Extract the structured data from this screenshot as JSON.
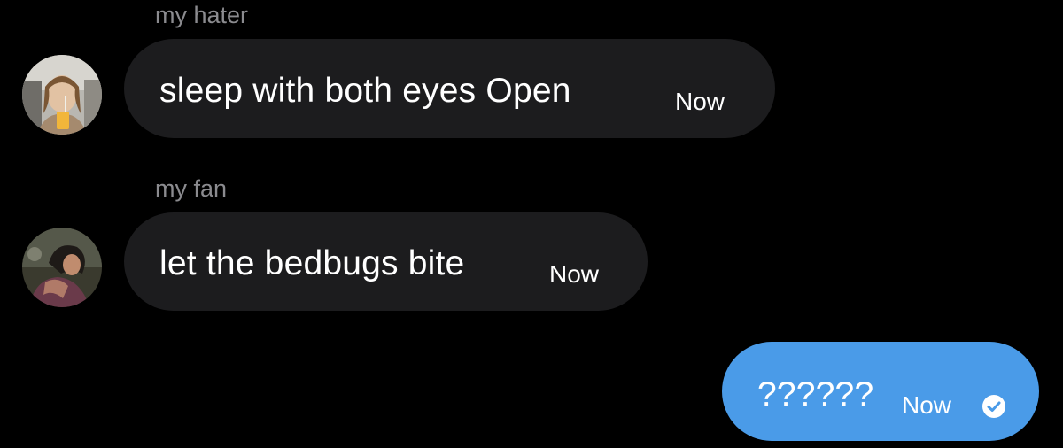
{
  "conversation": {
    "messages": [
      {
        "sender": "my hater",
        "text": "sleep with both eyes Open",
        "time": "Now",
        "direction": "incoming",
        "avatar_icon": "user-avatar-photo"
      },
      {
        "sender": "my fan",
        "text": "let the bedbugs bite",
        "time": "Now",
        "direction": "incoming",
        "avatar_icon": "user-avatar-photo"
      },
      {
        "sender": "",
        "text": "??????",
        "time": "Now",
        "direction": "outgoing",
        "status_icon": "read-check-icon"
      }
    ]
  },
  "colors": {
    "background": "#000000",
    "incoming_bubble": "#1c1c1e",
    "outgoing_bubble": "#4a9be8",
    "sender_name": "#8b8b8f",
    "text": "#ffffff"
  }
}
